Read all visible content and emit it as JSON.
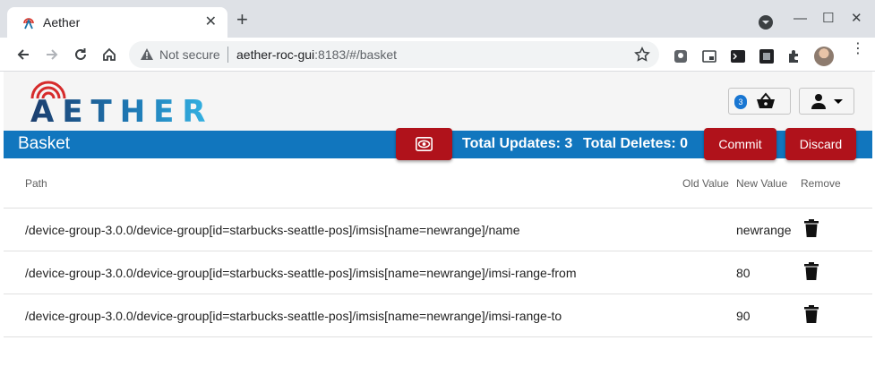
{
  "browser": {
    "tab_title": "Aether",
    "security_label": "Not secure",
    "url_host": "aether-roc-gui",
    "url_rest": ":8183/#/basket"
  },
  "header": {
    "logo_text": "AETHER",
    "basket_count": "3"
  },
  "titlebar": {
    "title": "Basket",
    "total_updates": "Total Updates: 3",
    "total_deletes": "Total Deletes: 0",
    "commit_label": "Commit",
    "discard_label": "Discard"
  },
  "table": {
    "columns": {
      "path": "Path",
      "old_value": "Old Value",
      "new_value": "New Value",
      "remove": "Remove"
    },
    "rows": [
      {
        "path": "/device-group-3.0.0/device-group[id=starbucks-seattle-pos]/imsis[name=newrange]/name",
        "old_value": "",
        "new_value": "newrange"
      },
      {
        "path": "/device-group-3.0.0/device-group[id=starbucks-seattle-pos]/imsis[name=newrange]/imsi-range-from",
        "old_value": "",
        "new_value": "80"
      },
      {
        "path": "/device-group-3.0.0/device-group[id=starbucks-seattle-pos]/imsis[name=newrange]/imsi-range-to",
        "old_value": "",
        "new_value": "90"
      }
    ]
  },
  "colors": {
    "titlebar": "#1176be",
    "action_red": "#b0121b",
    "badge_blue": "#1876d2"
  }
}
